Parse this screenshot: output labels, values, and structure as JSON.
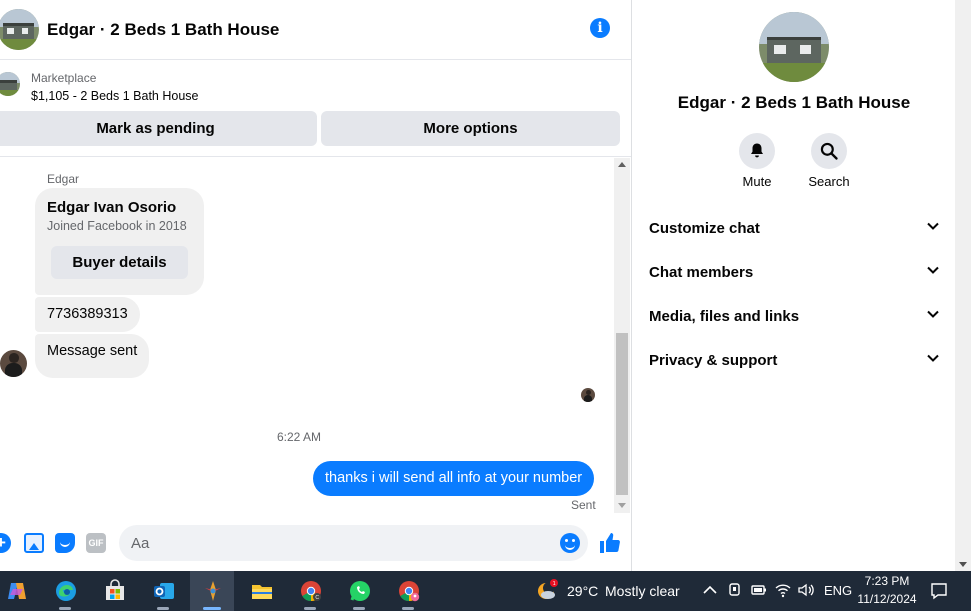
{
  "chat": {
    "header_title": "Edgar · 2 Beds 1 Bath House",
    "marketplace": {
      "label": "Marketplace",
      "listing": "$1,105 - 2 Beds 1 Bath House",
      "mark_pending_label": "Mark as pending",
      "more_options_label": "More options"
    },
    "messages": {
      "sender_name": "Edgar",
      "profile_card": {
        "name": "Edgar Ivan Osorio",
        "joined": "Joined Facebook in 2018",
        "buyer_details_label": "Buyer details"
      },
      "phone": "7736389313",
      "system_message": "Message sent",
      "timestamp": "6:22 AM",
      "outgoing": "thanks i will send all info at your number",
      "status": "Sent"
    },
    "composer": {
      "placeholder": "Aa",
      "gif_label": "GIF"
    }
  },
  "info_panel": {
    "title": "Edgar · 2 Beds 1 Bath House",
    "actions": [
      {
        "label": "Mute",
        "icon": "bell-icon"
      },
      {
        "label": "Search",
        "icon": "search-icon"
      }
    ],
    "sections": [
      {
        "label": "Customize chat"
      },
      {
        "label": "Chat members"
      },
      {
        "label": "Media, files and links"
      },
      {
        "label": "Privacy & support"
      }
    ]
  },
  "taskbar": {
    "apps": [
      "copilot-icon",
      "edge-icon",
      "store-icon",
      "outlook-icon",
      "app-icon",
      "file-explorer-icon",
      "chrome-icon",
      "whatsapp-icon",
      "chrome-profile-icon"
    ],
    "weather": {
      "temp": "29°C",
      "desc": "Mostly clear",
      "badge": "1"
    },
    "language": "ENG",
    "time": "7:23 PM",
    "date": "11/12/2024"
  },
  "colors": {
    "messenger_blue": "#0a7cff",
    "bubble_gray": "#f0f0f0",
    "taskbar": "#1f2a38"
  }
}
